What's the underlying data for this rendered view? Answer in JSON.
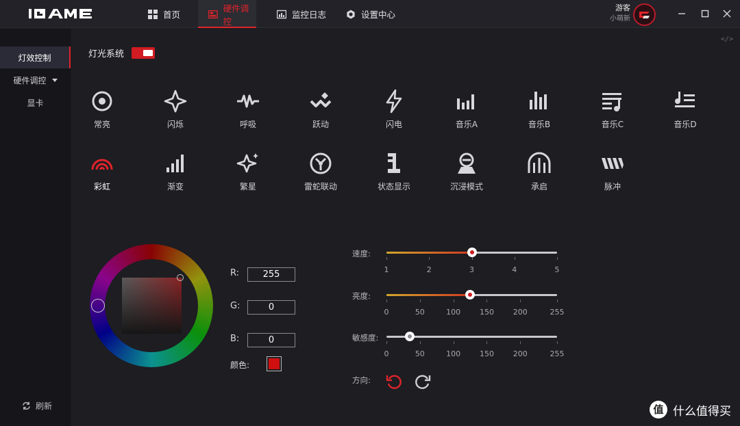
{
  "app": {
    "logo_text": "iGAME"
  },
  "nav": {
    "tabs": [
      {
        "label": "首页",
        "icon": "grid-icon"
      },
      {
        "label": "硬件调控",
        "icon": "hardware-icon",
        "active": true
      },
      {
        "label": "监控日志",
        "icon": "monitor-log-icon"
      },
      {
        "label": "设置中心",
        "icon": "settings-icon"
      }
    ]
  },
  "user": {
    "name": "游客",
    "subtitle": "小萌新"
  },
  "sidebar": {
    "items": [
      {
        "label": "灯效控制",
        "active": true
      },
      {
        "label": "硬件调控"
      },
      {
        "label": "显卡"
      }
    ],
    "refresh_label": "刷新"
  },
  "code_tag": "</>",
  "lighting": {
    "system_label": "灯光系统",
    "enabled": true,
    "effects": [
      {
        "label": "常亮",
        "icon": "circle-dot-icon"
      },
      {
        "label": "闪烁",
        "icon": "sparkle-outline-icon"
      },
      {
        "label": "呼吸",
        "icon": "pulse-wave-icon"
      },
      {
        "label": "跃动",
        "icon": "bounce-icon"
      },
      {
        "label": "闪电",
        "icon": "lightning-icon"
      },
      {
        "label": "音乐A",
        "icon": "bars-a-icon"
      },
      {
        "label": "音乐B",
        "icon": "bars-b-icon"
      },
      {
        "label": "音乐C",
        "icon": "music-note-icon"
      },
      {
        "label": "音乐D",
        "icon": "music-lines-icon"
      },
      {
        "label": "彩虹",
        "icon": "rainbow-icon",
        "selected": true
      },
      {
        "label": "渐变",
        "icon": "gradient-bars-icon"
      },
      {
        "label": "繁星",
        "icon": "stars-icon"
      },
      {
        "label": "雷蛇联动",
        "icon": "razer-link-icon"
      },
      {
        "label": "状态显示",
        "icon": "status-display-icon"
      },
      {
        "label": "沉浸模式",
        "icon": "immersive-icon"
      },
      {
        "label": "承启",
        "icon": "arch-icon"
      },
      {
        "label": "脉冲",
        "icon": "pulse-stripes-icon"
      }
    ],
    "rgb": {
      "r_label": "R:",
      "g_label": "G:",
      "b_label": "B:",
      "r": "255",
      "g": "0",
      "b": "0"
    },
    "color_label": "颜色:",
    "color": "#d01010",
    "speed": {
      "label": "速度:",
      "value": 3,
      "scale": [
        "1",
        "2",
        "3",
        "4",
        "5"
      ]
    },
    "brightness": {
      "label": "亮度:",
      "value": 125,
      "scale": [
        "0",
        "50",
        "100",
        "150",
        "200",
        "255"
      ]
    },
    "sensitivity": {
      "label": "敏感度:",
      "value": 35,
      "scale": [
        "0",
        "50",
        "100",
        "150",
        "200",
        "255"
      ]
    },
    "direction_label": "方向:",
    "direction": "counterclockwise"
  },
  "watermark": {
    "badge": "值",
    "text": "什么值得买"
  },
  "colors": {
    "accent": "#e0242a",
    "background": "#1d1d22",
    "sidebar_active": "#2a2b36"
  }
}
